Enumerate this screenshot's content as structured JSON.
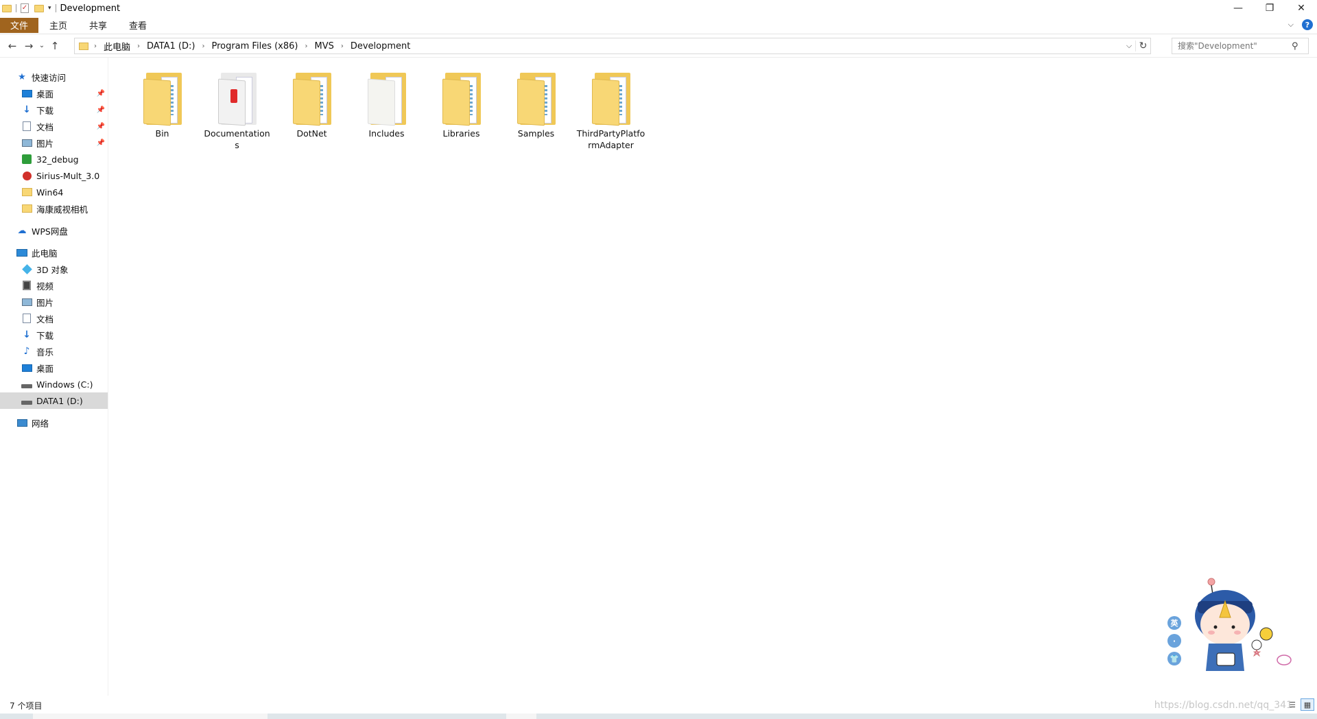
{
  "window": {
    "title": "Development",
    "minimize_label": "—",
    "restore_label": "❐",
    "close_label": "✕"
  },
  "ribbon": {
    "tabs": [
      "文件",
      "主页",
      "共享",
      "查看"
    ]
  },
  "address_bar": {
    "breadcrumbs": [
      "此电脑",
      "DATA1 (D:)",
      "Program Files (x86)",
      "MVS",
      "Development"
    ]
  },
  "search": {
    "placeholder": "搜索\"Development\""
  },
  "sidebar": {
    "quick_access": {
      "label": "快速访问",
      "items": [
        {
          "label": "桌面",
          "icon": "desktop-icon",
          "pinned": true
        },
        {
          "label": "下载",
          "icon": "download-icon",
          "pinned": true
        },
        {
          "label": "文档",
          "icon": "document-icon",
          "pinned": true
        },
        {
          "label": "图片",
          "icon": "picture-icon",
          "pinned": true
        },
        {
          "label": "32_debug",
          "icon": "app-icon",
          "pinned": false
        },
        {
          "label": "Sirius-Mult_3.0",
          "icon": "app-icon",
          "pinned": false
        },
        {
          "label": "Win64",
          "icon": "folder-icon",
          "pinned": false
        },
        {
          "label": "海康威视相机",
          "icon": "folder-icon",
          "pinned": false
        }
      ]
    },
    "wps": {
      "label": "WPS网盘"
    },
    "this_pc": {
      "label": "此电脑",
      "items": [
        {
          "label": "3D 对象",
          "icon": "3d-objects-icon"
        },
        {
          "label": "视频",
          "icon": "video-icon"
        },
        {
          "label": "图片",
          "icon": "picture-icon"
        },
        {
          "label": "文档",
          "icon": "document-icon"
        },
        {
          "label": "下载",
          "icon": "download-icon"
        },
        {
          "label": "音乐",
          "icon": "music-icon"
        },
        {
          "label": "桌面",
          "icon": "desktop-icon"
        },
        {
          "label": "Windows (C:)",
          "icon": "drive-icon"
        },
        {
          "label": "DATA1 (D:)",
          "icon": "drive-icon",
          "selected": true
        }
      ]
    },
    "network": {
      "label": "网络"
    }
  },
  "files": [
    {
      "name": "Bin",
      "type": "folder"
    },
    {
      "name": "Documentations",
      "type": "folder-doc"
    },
    {
      "name": "DotNet",
      "type": "folder"
    },
    {
      "name": "Includes",
      "type": "folder-inc"
    },
    {
      "name": "Libraries",
      "type": "folder"
    },
    {
      "name": "Samples",
      "type": "folder"
    },
    {
      "name": "ThirdPartyPlatformAdapter",
      "type": "folder"
    }
  ],
  "status": {
    "item_count": "7 个项目"
  },
  "watermark": "https://blog.csdn.net/qq_341",
  "widget": {
    "dot1": "英",
    "dot2": "·"
  }
}
